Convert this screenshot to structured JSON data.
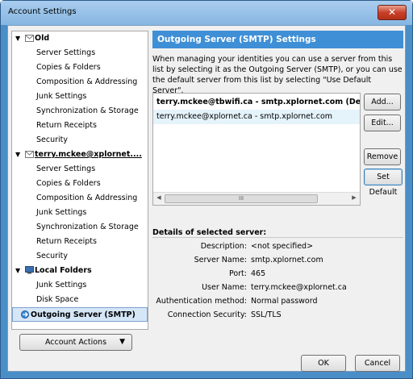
{
  "window": {
    "title": "Account Settings",
    "close_glyph": "✕"
  },
  "tree": {
    "items": [
      {
        "type": "account",
        "label": "Old",
        "icon": "mail-icon"
      },
      {
        "type": "sub",
        "label": "Server Settings"
      },
      {
        "type": "sub",
        "label": "Copies & Folders"
      },
      {
        "type": "sub",
        "label": "Composition & Addressing"
      },
      {
        "type": "sub",
        "label": "Junk Settings"
      },
      {
        "type": "sub",
        "label": "Synchronization & Storage"
      },
      {
        "type": "sub",
        "label": "Return Receipts"
      },
      {
        "type": "sub",
        "label": "Security"
      },
      {
        "type": "account",
        "label": "terry.mckee@xplornet....",
        "icon": "mail-icon"
      },
      {
        "type": "sub",
        "label": "Server Settings"
      },
      {
        "type": "sub",
        "label": "Copies & Folders"
      },
      {
        "type": "sub",
        "label": "Composition & Addressing"
      },
      {
        "type": "sub",
        "label": "Junk Settings"
      },
      {
        "type": "sub",
        "label": "Synchronization & Storage"
      },
      {
        "type": "sub",
        "label": "Return Receipts"
      },
      {
        "type": "sub",
        "label": "Security"
      },
      {
        "type": "account",
        "label": "Local Folders",
        "icon": "computer-icon"
      },
      {
        "type": "sub",
        "label": "Junk Settings"
      },
      {
        "type": "sub",
        "label": "Disk Space"
      },
      {
        "type": "selected",
        "label": "Outgoing Server (SMTP)",
        "icon": "outgoing-server-icon"
      }
    ],
    "account_actions": "Account Actions"
  },
  "panel": {
    "header": "Outgoing Server (SMTP) Settings",
    "description": "When managing your identities you can use a server from this list by selecting it as the Outgoing Server (SMTP), or you can use the default server from this list by selecting \"Use Default Server\".",
    "servers": [
      "terry.mckee@tbwifi.ca - smtp.xplornet.com (Default)",
      "terry.mckee@xplornet.ca - smtp.xplornet.com"
    ],
    "scroll_thumb": "III",
    "buttons": {
      "add": "Add...",
      "edit": "Edit...",
      "remove": "Remove",
      "set_default": "Set Default"
    },
    "details": {
      "heading": "Details of selected server:",
      "rows": [
        {
          "key": "Description:",
          "value": "<not specified>"
        },
        {
          "key": "Server Name:",
          "value": "smtp.xplornet.com"
        },
        {
          "key": "Port:",
          "value": "465"
        },
        {
          "key": "User Name:",
          "value": "terry.mckee@xplornet.ca"
        },
        {
          "key": "Authentication method:",
          "value": "Normal password"
        },
        {
          "key": "Connection Security:",
          "value": "SSL/TLS"
        }
      ]
    }
  },
  "footer": {
    "ok": "OK",
    "cancel": "Cancel"
  },
  "colors": {
    "header_blue": "#3f8fd6",
    "selection": "#d5e6f7"
  }
}
